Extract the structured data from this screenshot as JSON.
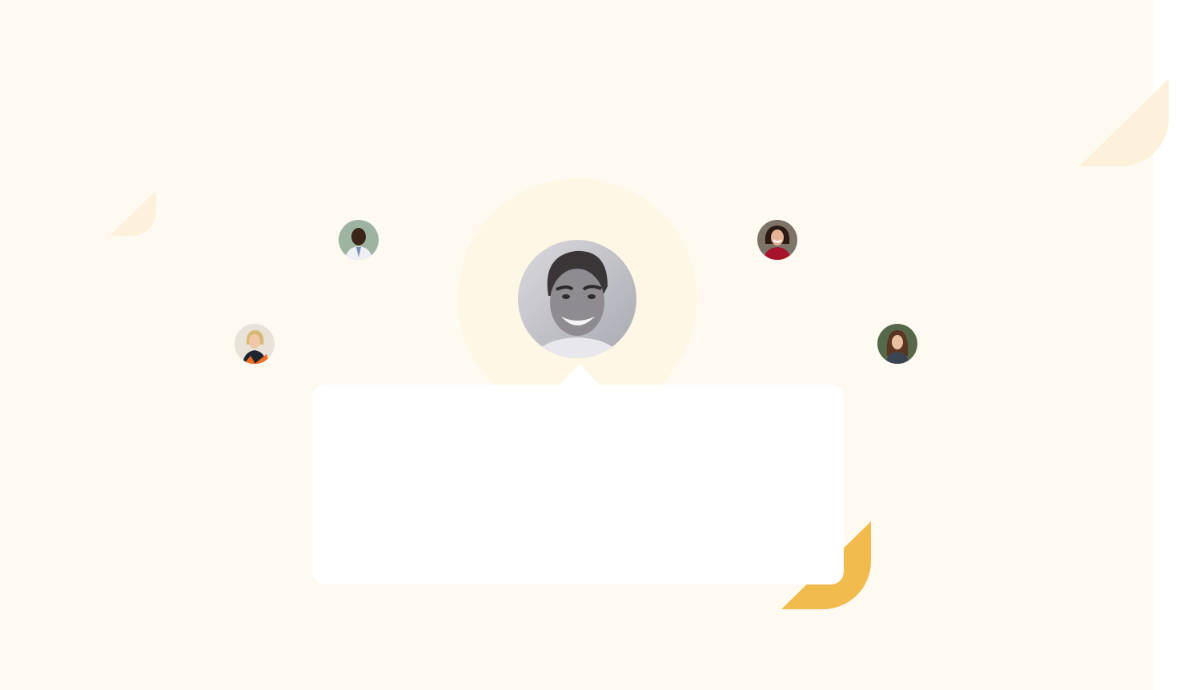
{
  "testimonial": {
    "quote": "",
    "author_name": "",
    "author_role": ""
  },
  "avatars": [
    {
      "name": "avatar-main",
      "icon": "person-photo"
    },
    {
      "name": "avatar-top-left",
      "icon": "person-photo"
    },
    {
      "name": "avatar-top-right",
      "icon": "person-photo"
    },
    {
      "name": "avatar-mid-left",
      "icon": "person-photo"
    },
    {
      "name": "avatar-mid-right",
      "icon": "person-photo"
    }
  ],
  "colors": {
    "background": "#fffaf1",
    "accent": "#f2bb4e",
    "accent_light": "#fdf1db",
    "card": "#ffffff"
  }
}
